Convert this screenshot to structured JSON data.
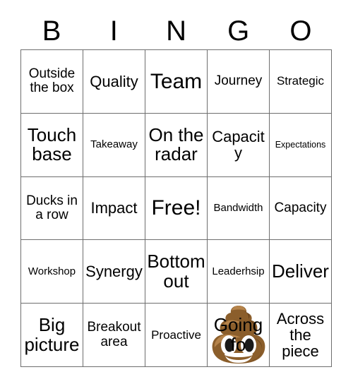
{
  "card": {
    "title": "BINGO",
    "header_letters": [
      "B",
      "I",
      "N",
      "G",
      "O"
    ],
    "colors": {
      "background": "#ffffff",
      "grid_line": "#6e6e6e",
      "text": "#000000",
      "stamp_brown_light": "#b5834a",
      "stamp_brown_mid": "#8b5e2b",
      "stamp_brown_dark": "#5d3a1a",
      "stamp_eye_white": "#ffffff",
      "stamp_eye_dark": "#1a1a1a"
    },
    "grid": {
      "rows": 5,
      "columns": 5,
      "cells": [
        [
          {
            "text": "Outside the box",
            "size": "lg",
            "marked": false
          },
          {
            "text": "Quality",
            "size": "xl",
            "marked": false
          },
          {
            "text": "Team",
            "size": "huge",
            "marked": false
          },
          {
            "text": "Journey",
            "size": "lg",
            "marked": false
          },
          {
            "text": "Strategic",
            "size": "md",
            "marked": false
          }
        ],
        [
          {
            "text": "Touch base",
            "size": "xxl",
            "marked": false
          },
          {
            "text": "Takeaway",
            "size": "sm",
            "marked": false
          },
          {
            "text": "On the radar",
            "size": "xxl",
            "marked": false
          },
          {
            "text": "Capacity",
            "size": "xl",
            "marked": false
          },
          {
            "text": "Expectations",
            "size": "xs",
            "marked": false
          }
        ],
        [
          {
            "text": "Ducks in a row",
            "size": "lg",
            "marked": false
          },
          {
            "text": "Impact",
            "size": "xl",
            "marked": false
          },
          {
            "text": "Free!",
            "size": "huge",
            "marked": false
          },
          {
            "text": "Bandwidth",
            "size": "sm",
            "marked": false
          },
          {
            "text": "Capacity",
            "size": "lg",
            "marked": false
          }
        ],
        [
          {
            "text": "Workshop",
            "size": "sm",
            "marked": false
          },
          {
            "text": "Synergy",
            "size": "xl",
            "marked": false
          },
          {
            "text": "Bottom out",
            "size": "xxl",
            "marked": false
          },
          {
            "text": "Leaderhsip",
            "size": "sm",
            "marked": false
          },
          {
            "text": "Deliver",
            "size": "xxl",
            "marked": false
          }
        ],
        [
          {
            "text": "Big picture",
            "size": "xxl",
            "marked": false
          },
          {
            "text": "Breakout area",
            "size": "lg",
            "marked": false
          },
          {
            "text": "Proactive",
            "size": "md",
            "marked": false
          },
          {
            "text": "Going fo",
            "size": "xxl",
            "marked": true,
            "stamp": "poop-emoji"
          },
          {
            "text": "Across the piece",
            "size": "xl",
            "marked": false
          }
        ]
      ]
    }
  }
}
